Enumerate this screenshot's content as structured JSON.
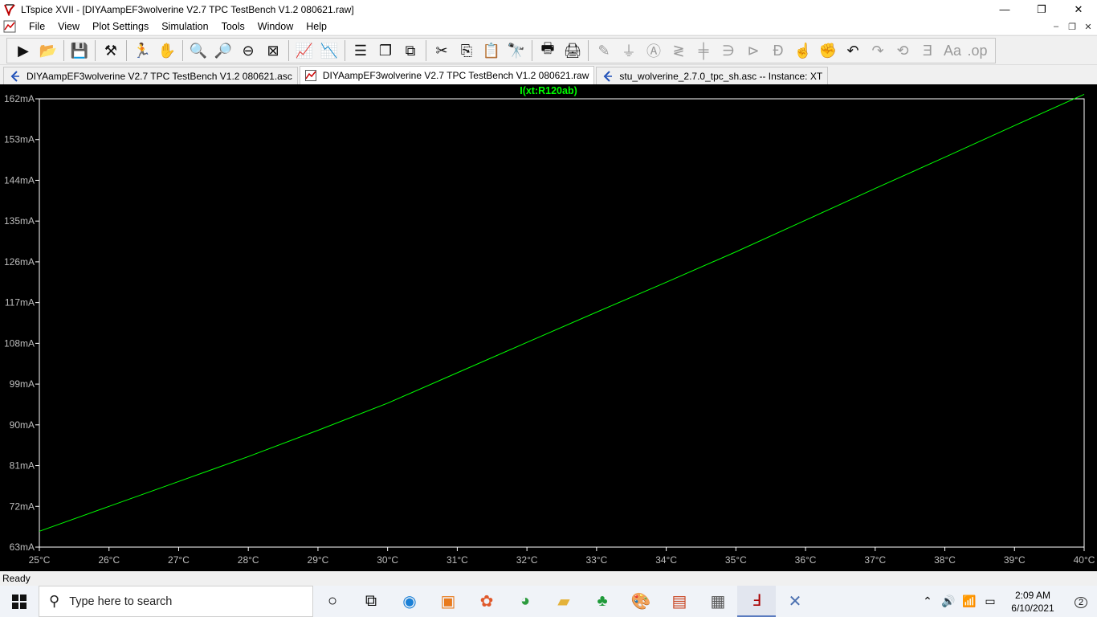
{
  "window": {
    "title": "LTspice XVII - [DIYAampEF3wolverine V2.7 TPC TestBench V1.2 080621.raw]",
    "controls": {
      "minimize": "—",
      "maximize": "❐",
      "close": "✕"
    }
  },
  "menu": {
    "items": [
      "File",
      "View",
      "Plot Settings",
      "Simulation",
      "Tools",
      "Window",
      "Help"
    ],
    "mdi": {
      "minimize": "–",
      "restore": "❐",
      "close": "✕"
    }
  },
  "tabs": [
    {
      "label": "DIYAampEF3wolverine V2.7 TPC TestBench V1.2 080621.asc",
      "icon": "schematic-icon"
    },
    {
      "label": "DIYAampEF3wolverine V2.7 TPC TestBench V1.2 080621.raw",
      "icon": "waveform-icon"
    },
    {
      "label": "stu_wolverine_2.7.0_tpc_sh.asc -- Instance: XT",
      "icon": "schematic-icon"
    }
  ],
  "status": "Ready",
  "taskbar": {
    "search_placeholder": "Type here to search",
    "time": "2:09 AM",
    "date": "6/10/2021",
    "notifications": "2"
  },
  "colors": {
    "plot_bg": "#000000",
    "trace": "#00ff00",
    "axis": "#ffffff"
  },
  "chart_data": {
    "type": "line",
    "title": "I(xt:R120ab)",
    "xlabel": "",
    "ylabel": "",
    "x_ticks": [
      "25°C",
      "26°C",
      "27°C",
      "28°C",
      "29°C",
      "30°C",
      "31°C",
      "32°C",
      "33°C",
      "34°C",
      "35°C",
      "36°C",
      "37°C",
      "38°C",
      "39°C",
      "40°C"
    ],
    "y_ticks": [
      "162mA",
      "153mA",
      "144mA",
      "135mA",
      "126mA",
      "117mA",
      "108mA",
      "99mA",
      "90mA",
      "81mA",
      "72mA",
      "63mA"
    ],
    "xlim": [
      25,
      40
    ],
    "ylim": [
      63,
      162
    ],
    "grid": false,
    "series": [
      {
        "name": "I(xt:R120ab)",
        "x": [
          25,
          26,
          27,
          28,
          29,
          30,
          31,
          32,
          33,
          34,
          35,
          36,
          37,
          38,
          39,
          40
        ],
        "y": [
          66.5,
          72.0,
          77.5,
          83.0,
          88.8,
          94.8,
          101.5,
          108.2,
          114.9,
          121.5,
          128.2,
          135.2,
          142.2,
          149.1,
          156.1,
          163.0
        ]
      }
    ]
  }
}
